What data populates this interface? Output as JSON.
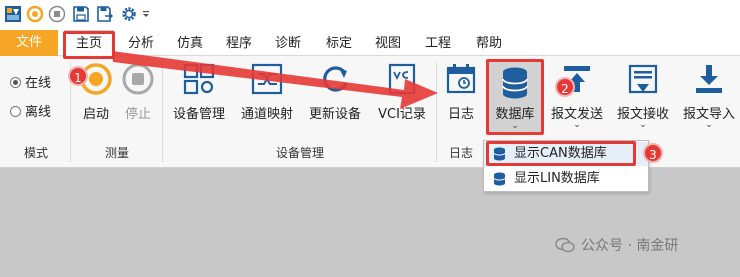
{
  "quick_access": {
    "icons": [
      "app-logo-icon",
      "connect-icon",
      "stop-icon",
      "save-icon",
      "save-as-icon",
      "settings-icon",
      "customize-dropdown-icon"
    ]
  },
  "menu": {
    "file": "文件",
    "items": [
      "主页",
      "分析",
      "仿真",
      "程序",
      "诊断",
      "标定",
      "视图",
      "工程",
      "帮助"
    ],
    "active_index": 0
  },
  "ribbon": {
    "mode": {
      "online_label": "在线",
      "offline_label": "离线",
      "selected": "在线",
      "group_label": "模式"
    },
    "measure": {
      "start_label": "启动",
      "stop_label": "停止",
      "group_label": "测量"
    },
    "device": {
      "manage_label": "设备管理",
      "channel_map_label": "通道映射",
      "update_label": "更新设备",
      "vci_record_label": "VCI记录",
      "group_label": "设备管理"
    },
    "log": {
      "log_label": "日志",
      "database_label": "数据库",
      "send_label": "报文发送",
      "receive_label": "报文接收",
      "import_label": "报文导入",
      "group_label": "日志"
    }
  },
  "dropdown": {
    "items": [
      "显示CAN数据库",
      "显示LIN数据库"
    ]
  },
  "annotations": {
    "step1": "1",
    "step2": "2",
    "step3": "3"
  },
  "watermark": "公众号 · 南金研",
  "colors": {
    "file_tab": "#f4a624",
    "highlight_red": "#e53935",
    "icon_blue": "#1e5e9e",
    "ribbon_bg": "#f7f7f7",
    "workspace_bg": "#c8c8c8"
  }
}
